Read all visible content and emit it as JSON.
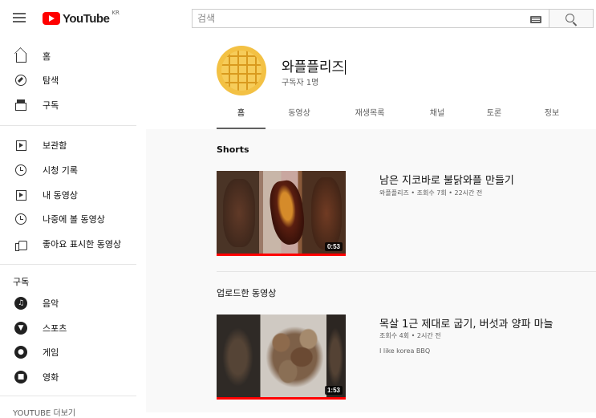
{
  "header": {
    "logo_text": "YouTube",
    "region": "KR",
    "search_placeholder": "검색"
  },
  "sidebar": {
    "main_items": [
      {
        "label": "홈",
        "icon": "home-icon"
      },
      {
        "label": "탐색",
        "icon": "compass-icon"
      },
      {
        "label": "구독",
        "icon": "subscriptions-icon"
      }
    ],
    "library_items": [
      {
        "label": "보관함",
        "icon": "library-icon"
      },
      {
        "label": "시청 기록",
        "icon": "history-icon"
      },
      {
        "label": "내 동영상",
        "icon": "my-videos-icon"
      },
      {
        "label": "나중에 볼 동영상",
        "icon": "watch-later-icon"
      },
      {
        "label": "좋아요 표시한 동영상",
        "icon": "liked-icon"
      }
    ],
    "subscriptions_heading": "구독",
    "subscription_items": [
      {
        "label": "음악",
        "icon": "music-icon"
      },
      {
        "label": "스포츠",
        "icon": "sports-icon"
      },
      {
        "label": "게임",
        "icon": "gaming-icon"
      },
      {
        "label": "영화",
        "icon": "movies-icon"
      }
    ],
    "more_heading": "YOUTUBE 더보기"
  },
  "channel": {
    "name": "와플플리즈",
    "subscribers": "구독자 1명",
    "tabs": [
      "홈",
      "동영상",
      "재생목록",
      "채널",
      "토론",
      "정보"
    ],
    "active_tab": "홈"
  },
  "sections": {
    "shorts_title": "Shorts",
    "uploads_title": "업로드한 동영상"
  },
  "videos": [
    {
      "title": "남은 지코바로 불닭와플 만들기",
      "meta": "와플플리즈 • 조회수 7회 • 22시간 전",
      "duration": "0:53",
      "description": ""
    },
    {
      "title": "목살 1근 제대로 굽기, 버섯과 양파 마늘",
      "meta": "조회수 4회 • 2시간 전",
      "duration": "1:53",
      "description": "I like korea BBQ"
    }
  ],
  "colors": {
    "brand_red": "#ff0000",
    "avatar": "#f3c144",
    "main_bg": "#f9f9f9"
  }
}
